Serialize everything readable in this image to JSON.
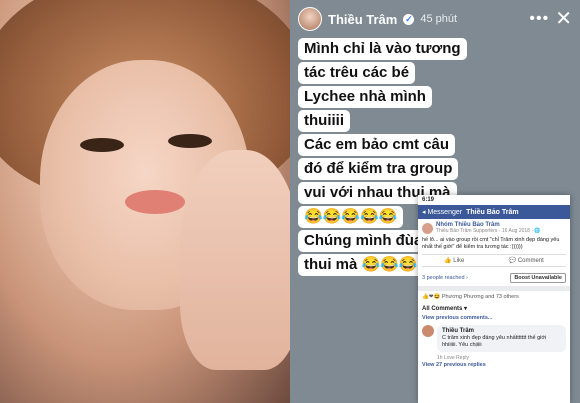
{
  "header": {
    "author": "Thiều Trâm",
    "time": "45 phút",
    "more_label": "•••",
    "close_label": "✕"
  },
  "caption_lines": [
    "Mình chỉ là vào tương",
    "tác trêu các bé",
    "Lychee nhà mình",
    "thuiiii",
    "Các em bảo cmt câu",
    "đó để kiểm tra group",
    "vui với nhau thui mà",
    "😂😂😂😂😂",
    "Chúng mình đùa vui",
    "thui mà 😂😂😂😂"
  ],
  "screenshot": {
    "status_time": "6:19",
    "back_label": "◂ Messenger",
    "nav_title": "Thiều Bảo Trâm",
    "group_name": "Nhóm Thiều Bảo Trâm",
    "group_meta": "Thiều Bảo Trâm Supporters · 16 Aug 2018 · 🌐",
    "post_text": "hế lô... ai vào group rồi cmt \"chỉ Trâm xinh đẹp đáng yêu nhất thế giới\" để kiểm tra tương tác :))))))",
    "like_label": "👍 Like",
    "comment_label": "💬 Comment",
    "reach_text": "3 people reached ›",
    "boost_label": "Boost Unavailable",
    "reactions_text": "👍❤😆 Phương Phương and 73 others",
    "all_comments_label": "All Comments ▾",
    "view_previous_label": "View previous comments...",
    "commenter_name": "Thiều Trâm",
    "comment_text": "C trâm xinh đẹp đáng yêu nhấttttttt thế giới hhiiiiii. Yêu chịiiii",
    "comment_meta": "1h   Love   Reply",
    "more_replies_label": "View 27 previous replies"
  }
}
